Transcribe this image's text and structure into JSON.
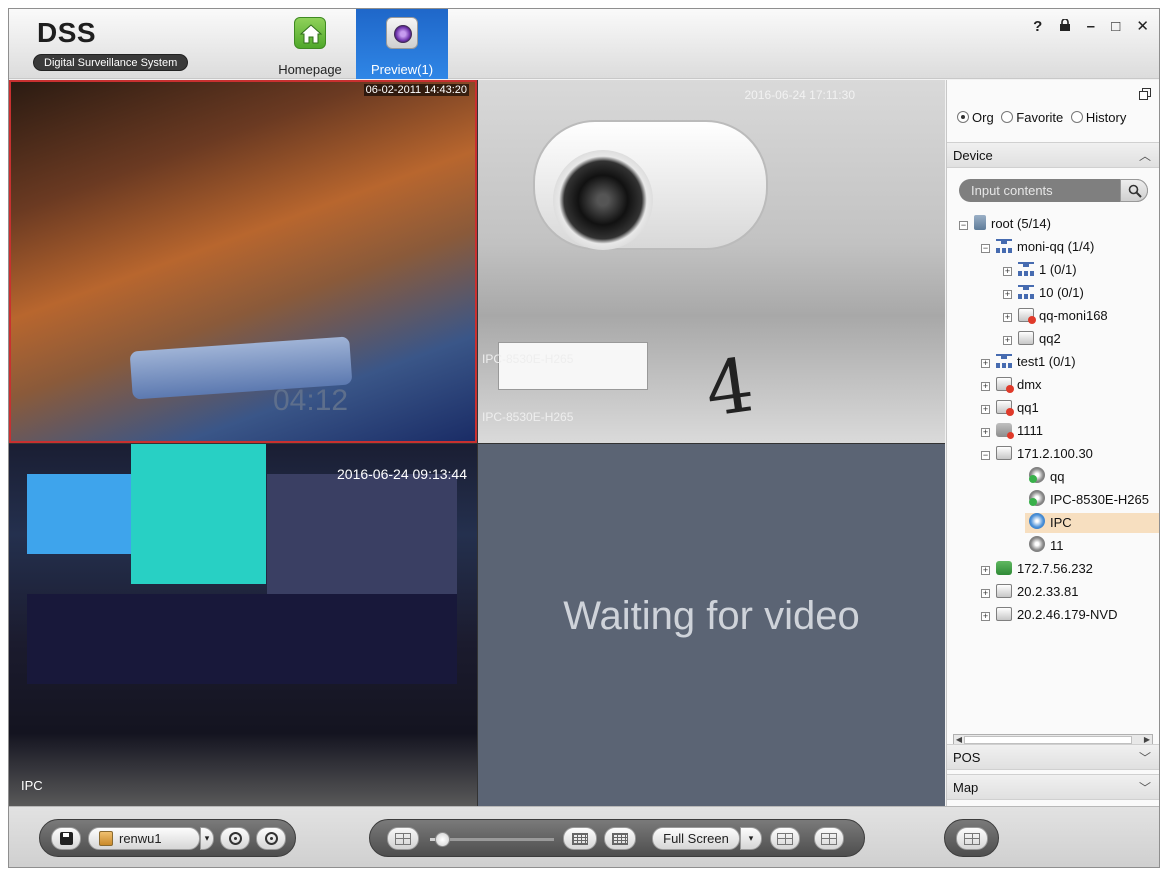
{
  "header": {
    "logo_title": "DSS",
    "logo_subtitle": "Digital Surveillance System",
    "tabs": [
      {
        "label": "Homepage",
        "icon": "home-icon"
      },
      {
        "label": "Preview(1)",
        "icon": "preview-camera-icon",
        "active": true
      }
    ],
    "window_controls": [
      "?",
      "🔒",
      "–",
      "□",
      "✕"
    ]
  },
  "video": {
    "windows": [
      {
        "timestamp": "06-02-2011 14:43:20",
        "selected": true
      },
      {
        "timestamp": "2016-06-24 17:11:30",
        "labels": [
          "IPC-8530E-H265",
          "IPC-8530E-H265"
        ]
      },
      {
        "timestamp": "2016-06-24 09:13:44",
        "label": "IPC"
      },
      {
        "status": "Waiting for video"
      }
    ],
    "scene_text": {
      "proj_time": "04:12",
      "digit": "4"
    }
  },
  "panel": {
    "modes": [
      {
        "label": "Org",
        "checked": true
      },
      {
        "label": "Favorite",
        "checked": false
      },
      {
        "label": "History",
        "checked": false
      }
    ],
    "device_header": "Device",
    "search": {
      "placeholder": "Input contents"
    },
    "tree": [
      {
        "label": "root (5/14)",
        "exp": "−"
      },
      {
        "label": "moni-qq (1/4)",
        "exp": "−"
      },
      {
        "label": "1 (0/1)",
        "exp": "+"
      },
      {
        "label": "10 (0/1)",
        "exp": "+"
      },
      {
        "label": "qq-moni168",
        "exp": "+"
      },
      {
        "label": "qq2",
        "exp": "+"
      },
      {
        "label": "test1 (0/1)",
        "exp": "+"
      },
      {
        "label": "dmx",
        "exp": "+"
      },
      {
        "label": "qq1",
        "exp": "+"
      },
      {
        "label": "1111",
        "exp": "+"
      },
      {
        "label": "171.2.100.30",
        "exp": "−"
      },
      {
        "label": "qq"
      },
      {
        "label": "IPC-8530E-H265"
      },
      {
        "label": "IPC",
        "selected": true
      },
      {
        "label": "11"
      },
      {
        "label": "172.7.56.232",
        "exp": "+"
      },
      {
        "label": "20.2.33.81",
        "exp": "+"
      },
      {
        "label": "20.2.46.179-NVD",
        "exp": "+"
      }
    ],
    "pos_header": "POS",
    "map_header": "Map"
  },
  "toolbar": {
    "task_label": "renwu1",
    "fullscreen_label": "Full Screen",
    "drop_arrow": "▾"
  },
  "colors": {
    "active_tab": "#2f86e6",
    "selected_window_border": "#c83030",
    "selected_tree_item": "#f7dfc0"
  }
}
